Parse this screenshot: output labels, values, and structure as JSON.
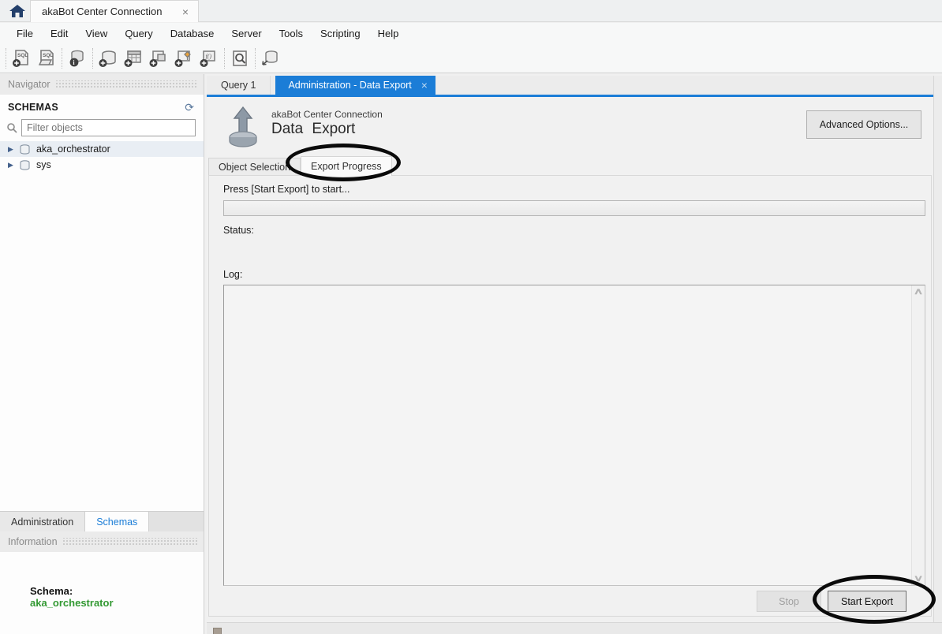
{
  "window": {
    "title_tab": "akaBot Center Connection",
    "close_glyph": "×"
  },
  "menu": {
    "items": [
      "File",
      "Edit",
      "View",
      "Query",
      "Database",
      "Server",
      "Tools",
      "Scripting",
      "Help"
    ]
  },
  "toolbar": {
    "icons": [
      "new-sql-tab-icon",
      "open-sql-script-icon",
      "inspector-icon",
      "create-schema-icon",
      "create-table-icon",
      "create-view-icon",
      "create-procedure-icon",
      "create-function-icon",
      "search-table-data-icon",
      "reconnect-database-icon"
    ]
  },
  "sidebar": {
    "navigator_title": "Navigator",
    "schemas_header": "SCHEMAS",
    "filter_placeholder": "Filter objects",
    "tree": [
      {
        "label": "aka_orchestrator"
      },
      {
        "label": "sys"
      }
    ],
    "tabs": [
      {
        "label": "Administration"
      },
      {
        "label": "Schemas"
      }
    ],
    "information_title": "Information",
    "info": {
      "schema_label": "Schema:",
      "schema_name": "aka_orchestrator"
    }
  },
  "main": {
    "doc_tabs": [
      {
        "label": "Query 1"
      },
      {
        "label": "Administration - Data Export"
      }
    ],
    "header": {
      "connection": "akaBot Center Connection",
      "title": "Data Export",
      "advanced_button": "Advanced Options..."
    },
    "subtabs": [
      {
        "label": "Object Selection"
      },
      {
        "label": "Export Progress"
      }
    ],
    "progress": {
      "prompt": "Press [Start Export] to start...",
      "status_label": "Status:",
      "log_label": "Log:"
    },
    "footer": {
      "stop": "Stop",
      "start": "Start Export"
    }
  },
  "colors": {
    "accent_blue": "#1b7dd7",
    "schema_green": "#339933",
    "annotation": "#000000"
  }
}
